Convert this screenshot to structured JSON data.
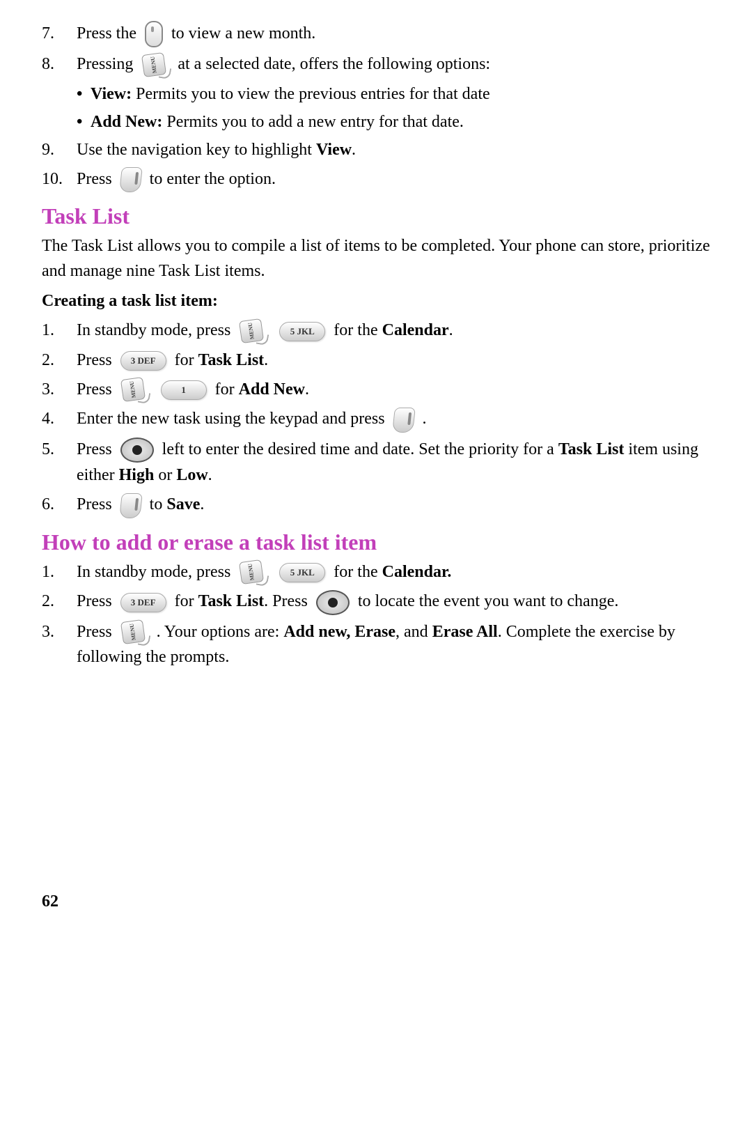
{
  "page_number": "62",
  "top_list": {
    "item7": {
      "num": "7.",
      "pre": "Press the ",
      "post": " to view a new month."
    },
    "item8": {
      "num": "8.",
      "pre": "Pressing ",
      "post": " at a selected date, offers the following options:"
    },
    "bullets": {
      "b1_label": "View:",
      "b1_text": " Permits you to view the previous entries for that date",
      "b2_label": "Add New:",
      "b2_text": " Permits you to add a new entry for that date."
    },
    "item9": {
      "num": "9.",
      "text_a": "Use the navigation key to highlight ",
      "text_b": "View",
      "text_c": "."
    },
    "item10": {
      "num": "10.",
      "pre": "Press ",
      "post": " to enter the option."
    }
  },
  "section_task_list": {
    "title": "Task List",
    "intro": "The Task List allows you to compile a list of items to be completed. Your phone can store, prioritize and manage nine Task List items.",
    "subhead": "Creating a task list item:",
    "items": {
      "i1": {
        "num": "1.",
        "a": "In standby mode, press ",
        "b": " for the ",
        "c": "Calendar",
        "d": "."
      },
      "i2": {
        "num": "2.",
        "a": "Press ",
        "b": " for ",
        "c": "Task List",
        "d": "."
      },
      "i3": {
        "num": "3.",
        "a": "Press ",
        "b": " for ",
        "c": "Add New",
        "d": "."
      },
      "i4": {
        "num": "4.",
        "a": "Enter the new task using the keypad and press ",
        "b": "."
      },
      "i5": {
        "num": "5.",
        "a": "Press ",
        "b": " left to enter the desired time and date. Set the priority for a ",
        "c": "Task List",
        "d": " item using either ",
        "e": "High",
        "f": " or ",
        "g": "Low",
        "h": "."
      },
      "i6": {
        "num": "6.",
        "a": "Press ",
        "b": " to ",
        "c": "Save",
        "d": "."
      }
    }
  },
  "section_add_erase": {
    "title": "How to add or erase a task list item",
    "items": {
      "i1": {
        "num": "1.",
        "a": "In standby mode, press ",
        "b": " for the ",
        "c": "Calendar.",
        "d": ""
      },
      "i2": {
        "num": "2.",
        "a": "Press ",
        "b": " for ",
        "c": "Task List",
        "d": ". Press ",
        "e": " to locate the event you want to change."
      },
      "i3": {
        "num": "3.",
        "a": "Press ",
        "b": ". Your options are: ",
        "c": "Add new, Erase",
        "d": ", and ",
        "e": "Erase All",
        "f": ". Complete the exercise by following the prompts."
      }
    }
  },
  "key_labels": {
    "menu": "MENU",
    "k5": "5 JKL",
    "k3": "3 DEF",
    "k1": "1"
  }
}
